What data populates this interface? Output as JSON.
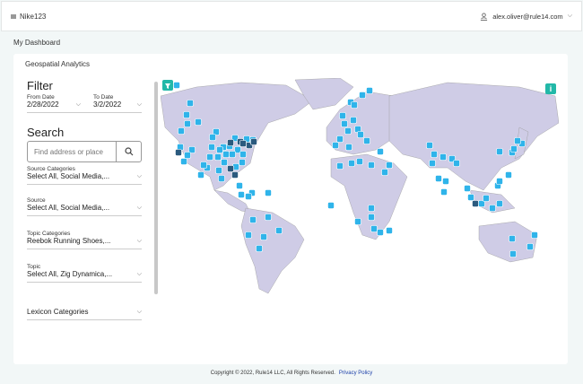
{
  "header": {
    "app_name": "Nike123",
    "user_email": "alex.oliver@rule14.com"
  },
  "breadcrumb": "My Dashboard",
  "card": {
    "title": "Geospatial Analytics"
  },
  "filter": {
    "title": "Filter",
    "from_date_label": "From Date",
    "from_date": "2/28/2022",
    "to_date_label": "To Date",
    "to_date": "3/2/2022",
    "search_title": "Search",
    "search_placeholder": "Find address or place",
    "fields": [
      {
        "label": "Source Categories",
        "value": "Select All, Social Media,..."
      },
      {
        "label": "Source",
        "value": "Select All, Social Media,..."
      },
      {
        "label": "Topic Categories",
        "value": "Reebok Running Shoes,..."
      },
      {
        "label": "Topic",
        "value": "Select All, Zig Dynamica,..."
      },
      {
        "label": "",
        "value": "Lexicon Categories"
      }
    ]
  },
  "map": {
    "land_color": "#cfcce6",
    "marker_color": "#2fb4ea",
    "marker_dark_color": "#2b5a7e",
    "marker_icon": "twitter-bird-icon",
    "info_label": "i"
  },
  "footer": {
    "copyright": "Copyright © 2022, Rule14 LLC, All Rights Reserved.",
    "privacy_link": "Privacy Policy"
  }
}
